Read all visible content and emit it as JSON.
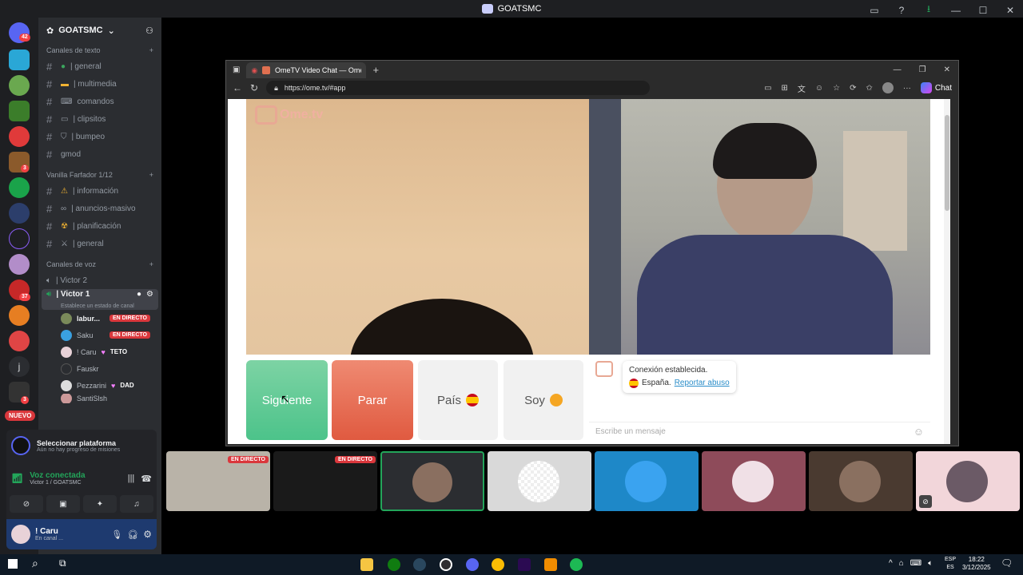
{
  "window": {
    "title": "GOATSMC"
  },
  "server": {
    "name": "GOATSMC",
    "rail_badges": [
      "42",
      "3",
      "3",
      "37",
      "3"
    ],
    "new_label": "NUEVO",
    "letter_item": "j"
  },
  "categories": {
    "text": "Canales de texto",
    "vanilla": "Vanilla Farfador 1/12",
    "voice": "Canales de voz"
  },
  "text_channels": [
    {
      "label": "| general"
    },
    {
      "label": "| multimedia"
    },
    {
      "label": "comandos"
    },
    {
      "label": "| clipsitos"
    },
    {
      "label": "| bumpeo"
    },
    {
      "label": "gmod"
    }
  ],
  "vanilla_channels": [
    {
      "label": "| información"
    },
    {
      "label": "| anuncios-masivo"
    },
    {
      "label": "| planificación"
    },
    {
      "label": "| general"
    }
  ],
  "voice_channels": [
    {
      "label": "| Victor 2"
    },
    {
      "label": "| Victor 1",
      "status": "Establece un estado de canal"
    }
  ],
  "voice_users": [
    {
      "name": "labur...",
      "tag": "EN DIRECTO"
    },
    {
      "name": "Saku",
      "tag": "EN DIRECTO"
    },
    {
      "name": "! Caru",
      "tag": "TETO"
    },
    {
      "name": "Fauskr",
      "tag": ""
    },
    {
      "name": "Pezzarini",
      "tag": "DAD"
    },
    {
      "name": "SantiSlsh",
      "tag": ""
    }
  ],
  "platform": {
    "title": "Seleccionar plataforma",
    "subtitle": "Aún no hay progreso de misiones"
  },
  "voice": {
    "status": "Voz conectada",
    "channel": "Victor 1 / GOATSMC"
  },
  "user": {
    "name": "! Caru",
    "status": "En canal ..."
  },
  "browser": {
    "tab_title": "OmeTV Video Chat — Ome",
    "url": "https://ome.tv/#app",
    "chat_label": "Chat"
  },
  "ometv": {
    "logo": "Ome.tv",
    "buttons": {
      "next": "Siguiente",
      "stop": "Parar",
      "country": "País",
      "gender": "Soy"
    },
    "message1": "Conexión establecida.",
    "country_text": "España.",
    "report_link": "Reportar abuso",
    "chat_placeholder": "Escribe un mensaje"
  },
  "thumbs": {
    "live_label": "EN DIRECTO"
  },
  "taskbar": {
    "lang1": "ESP",
    "lang2": "ES",
    "time": "18:22",
    "date": "3/12/2025"
  }
}
